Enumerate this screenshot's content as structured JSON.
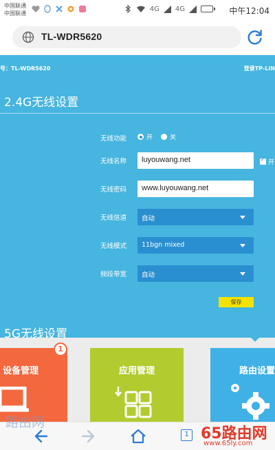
{
  "status_bar": {
    "carrier_1": "中国联通",
    "carrier_2": "中国联通",
    "network_1": "4G",
    "network_2": "4G",
    "time": "中午12:04"
  },
  "browser": {
    "url": "TL-WDR5620"
  },
  "router_page": {
    "model_label": "号：TL-WDR5620",
    "login_label": "登录TP-LIN",
    "wireless_24g": {
      "title": "2.4G无线设置",
      "wireless_function_label": "无线功能",
      "on_label": "开",
      "off_label": "关",
      "wireless_function_value": "on",
      "ssid_label": "无线名称",
      "ssid_value": "luyouwang.net",
      "hide_label": "开",
      "password_label": "无线密码",
      "password_value": "www.luyouwang.net",
      "channel_label": "无线信道",
      "channel_value": "自动",
      "mode_label": "无线模式",
      "mode_value": "11bgn mixed",
      "bandwidth_label": "频段带宽",
      "bandwidth_value": "自动",
      "save_label": "保存"
    },
    "wireless_5g": {
      "title": "5G无线设置"
    }
  },
  "tiles": [
    {
      "title": "设备管理",
      "badge": "1",
      "color": "#f4683f"
    },
    {
      "title": "应用管理",
      "color": "#b2cb2f"
    },
    {
      "title": "路由设置",
      "color": "#3fb1e6"
    }
  ],
  "nav": {
    "tab_count": "1"
  },
  "watermark": {
    "left_text": "路由网",
    "right_text": "65路由网",
    "right_url": "www.65ly.com"
  },
  "colors": {
    "page_bg": "#46b5df",
    "select_bg": "#2a8fd0",
    "save_button": "#f3e300"
  }
}
